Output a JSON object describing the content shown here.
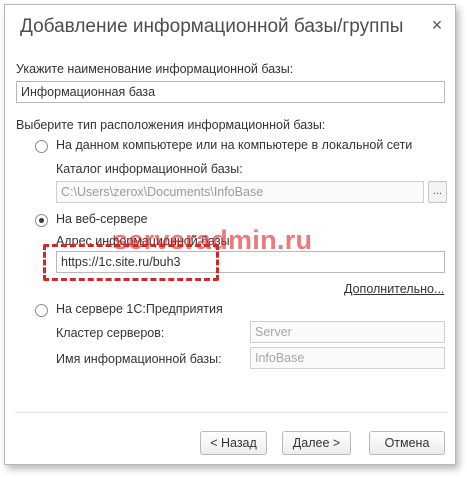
{
  "dialog": {
    "title": "Добавление информационной базы/группы",
    "close_glyph": "×"
  },
  "name_section": {
    "label": "Укажите наименование информационной базы:",
    "value": "Информационная база"
  },
  "location_section": {
    "label": "Выберите тип расположения информационной базы:",
    "options": [
      {
        "label": "На данном компьютере или на компьютере в локальной сети",
        "selected": false,
        "sub_label": "Каталог информационной базы:",
        "path_value": "C:\\Users\\zerox\\Documents\\InfoBase",
        "browse_label": "..."
      },
      {
        "label": "На веб-сервере",
        "selected": true,
        "sub_label": "Адрес информационной базы",
        "address_value": "https://1c.site.ru/buh3",
        "more_link": "Дополнительно..."
      },
      {
        "label": "На сервере 1С:Предприятия",
        "selected": false,
        "cluster_label": "Кластер серверов:",
        "cluster_placeholder": "Server",
        "infobase_label": "Имя информационной базы:",
        "infobase_placeholder": "InfoBase"
      }
    ]
  },
  "watermark": "serveradmin.ru",
  "buttons": {
    "back": "< Назад",
    "next": "Далее >",
    "cancel": "Отмена"
  },
  "colors": {
    "highlight_border": "#d42727",
    "watermark": "#e12828"
  }
}
